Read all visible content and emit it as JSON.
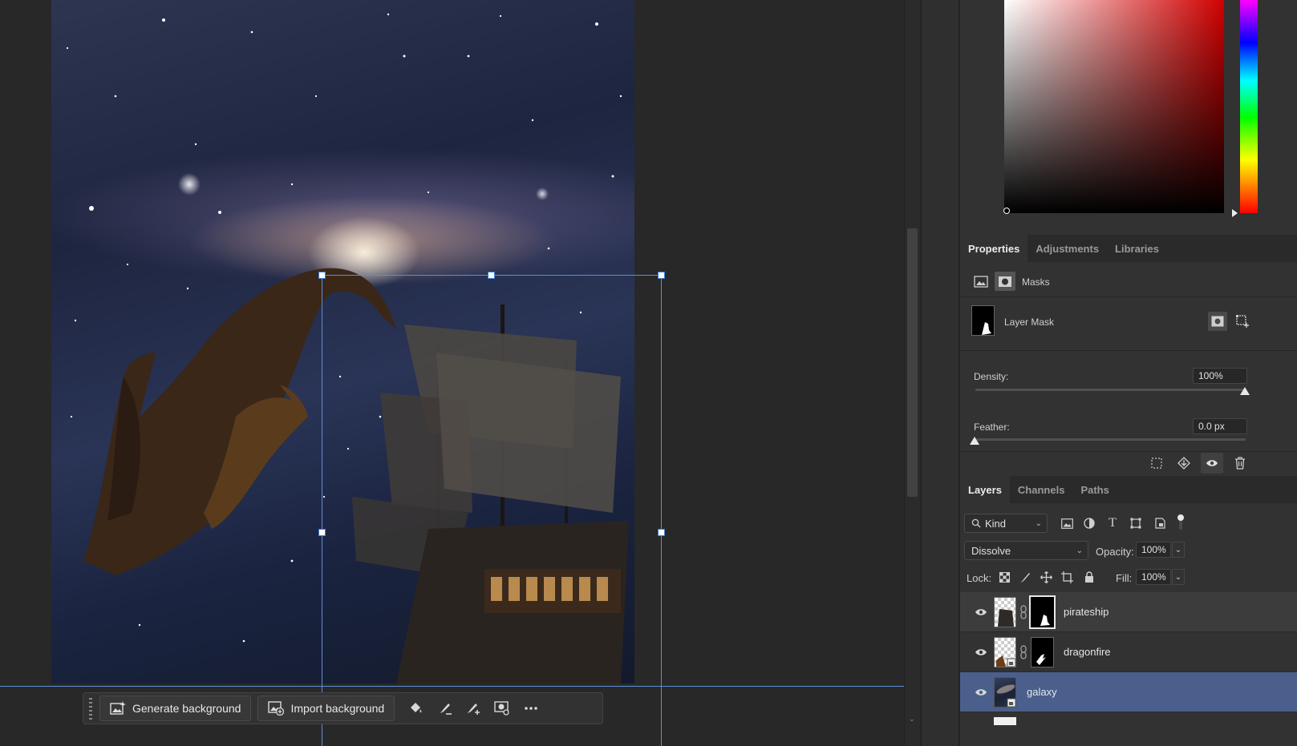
{
  "taskbar": {
    "generate_label": "Generate background",
    "import_label": "Import background"
  },
  "properties": {
    "tabs": [
      "Properties",
      "Adjustments",
      "Libraries"
    ],
    "section_label": "Masks",
    "mask_name": "Layer Mask",
    "density_label": "Density:",
    "density_value": "100%",
    "density_level": 1.0,
    "feather_label": "Feather:",
    "feather_value": "0.0 px",
    "feather_level": 0.0
  },
  "layers_panel": {
    "tabs": [
      "Layers",
      "Channels",
      "Paths"
    ],
    "filter_label": "Kind",
    "blend_mode": "Dissolve",
    "opacity_label": "Opacity:",
    "opacity_value": "100%",
    "lock_label": "Lock:",
    "fill_label": "Fill:",
    "fill_value": "100%",
    "layers": [
      {
        "name": "pirateship",
        "has_mask": true,
        "selected_light": true
      },
      {
        "name": "dragonfire",
        "has_mask": true
      },
      {
        "name": "galaxy",
        "active": true
      }
    ]
  },
  "colors": {
    "accent_blue": "#5d8fd6",
    "selected_layer": "#4a5f8c",
    "panel_bg": "#323232"
  }
}
